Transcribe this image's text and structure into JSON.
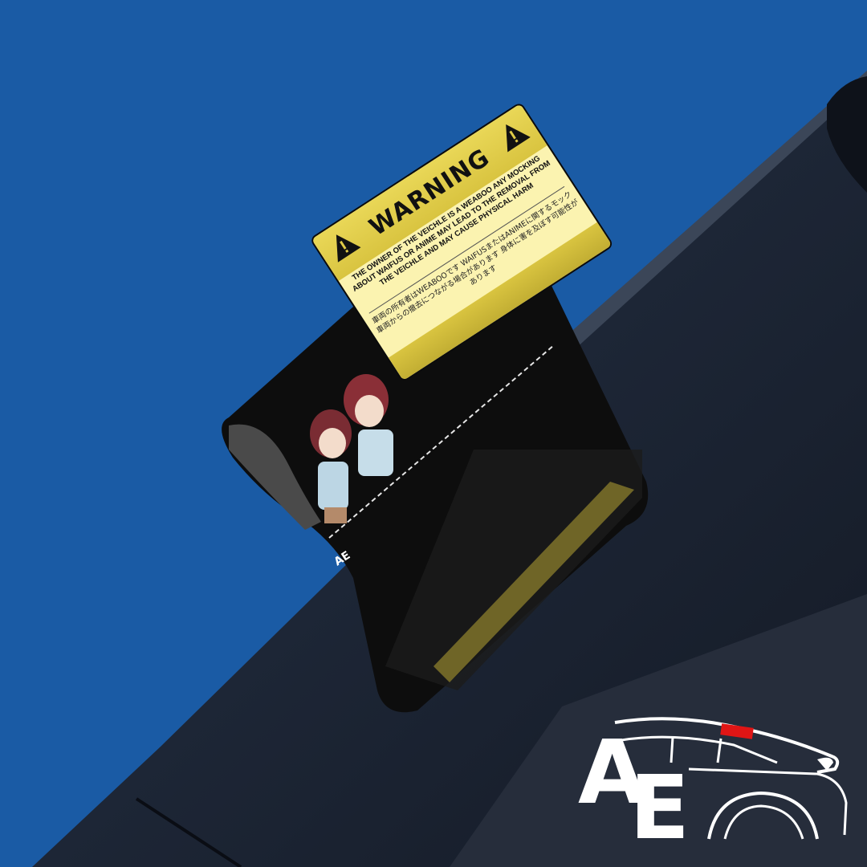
{
  "sticker": {
    "title": "WARNING",
    "message_en": "THE OWNER OF THE VEICHLE IS A WEABOO ANY MOCKING ABOUT WAIFUS OR ANIME MAY LEAD TO THE REMOVAL FROM THE VEICHLE AND MAY CAUSE PHYSICAL HARM",
    "message_jp": "車両の所有者はWEABOOです WAIFUSまたはANIMEに関するモック 車両からの撤去につながる場合があります 身体に害を及ぼす可能性があります"
  },
  "logo": {
    "letters": "AE"
  },
  "colors": {
    "background": "#1a5ba5",
    "car_dark": "#1c2433",
    "sticker_yellow": "#e0cb48",
    "logo_accent": "#e01515"
  }
}
